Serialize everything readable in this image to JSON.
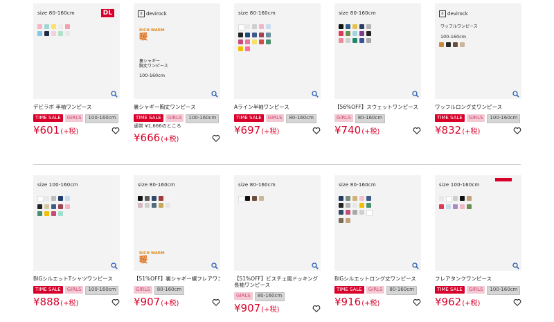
{
  "row1": [
    {
      "name": "デビラボ 半袖ワンピース",
      "tags": [
        "TIME SALE",
        "GIRLS",
        "100-160cm"
      ],
      "note": "",
      "price": "¥601",
      "tax": "(+税)",
      "size_label": "size 80-160cm",
      "brand_badge": "DL",
      "swatch_colors": [
        "#f5b5c4",
        "#9ed8d2",
        "#ffe06b",
        "#ececec",
        "#f3a0b0",
        "#88c6e6",
        "#242b47",
        "#f2d2da",
        "#b3e1c7",
        "#e8e8e8"
      ],
      "dress": "#a7dcd6",
      "hair": "#3a2a20",
      "skin": "#f1d0b6"
    },
    {
      "name": "裏シャギー胸丈ワンピース",
      "tags": [
        "TIME SALE",
        "GIRLS",
        "100-160cm"
      ],
      "note": "通常 ¥1,666のところ",
      "price": "¥666",
      "tax": "(+税)",
      "brand_text": "devirock",
      "warm_title": "RICH WARM",
      "warm_kanji": "暖",
      "feature_text": "裏シャギー\n胸丈ワンピース",
      "size_range": "100-160cm",
      "dress": "#5c4a3d",
      "hair": "#2b1e16",
      "skin": "#eed0b6"
    },
    {
      "name": "Aライン半袖ワンピース",
      "tags": [
        "TIME SALE",
        "GIRLS",
        "80-160cm"
      ],
      "note": "",
      "price": "¥697",
      "tax": "(+税)",
      "size_label": "size 80-160cm",
      "swatch_colors": [
        "#ffffff",
        "#e8e8e8",
        "#cfcfcf",
        "#f0b7c6",
        "#c7ddf0",
        "#222222",
        "#1f4a7c",
        "#3e5c8a",
        "#9e4454",
        "#6a8ea4",
        "#c84b78",
        "#e07aa0",
        "#f4e26b",
        "#d24b4b",
        "#4a8f70",
        "#f0c000",
        "#ff6f9c"
      ],
      "dress": "#9dd2c8",
      "hair": "#2b1e16",
      "skin": "#f1d2b9"
    },
    {
      "name": "【56%OFF】スウェットワンピース",
      "tags": [
        "GIRLS",
        "80-160cm"
      ],
      "note": "",
      "price": "¥740",
      "tax": "(+税)",
      "size_label": "size 80-160cm",
      "swatch_colors": [
        "#111111",
        "#2f5f88",
        "#e8c24e",
        "#2a3d5e",
        "#b4b4b4",
        "#d83a57",
        "#6b8f4e",
        "#a2d3e0",
        "#7c3e8c",
        "#232323",
        "#ef8a9b",
        "#cfcfcf",
        "#1e8a6a",
        "#3b4f9c",
        "#a8a8a8"
      ],
      "dress": "#232a34",
      "hair": "#1f150e",
      "skin": "#f1d2b9"
    },
    {
      "name": "ワッフルロング丈ワンピース",
      "tags": [
        "TIME SALE",
        "GIRLS",
        "100-160cm"
      ],
      "note": "",
      "price": "¥832",
      "tax": "(+税)",
      "brand_text": "devirock",
      "feature_text": "ワッフルワンピース",
      "size_range": "100-160cm",
      "swatch_colors": [
        "#c9893c",
        "#2a2a2a",
        "#6b4e3a",
        "#cdb59a"
      ],
      "dress": "#bb7432",
      "hair": "#3a2818",
      "skin": "#eed0b6"
    }
  ],
  "row2": [
    {
      "name": "BIGシルエットTシャツワンピース",
      "tags": [
        "TIME SALE",
        "GIRLS",
        "100-160cm"
      ],
      "note": "",
      "price": "¥888",
      "tax": "(+税)",
      "size_label": "size 100-160cm",
      "swatch_colors": [
        "#ffffff",
        "#e8e8e8",
        "#bcbcbc",
        "#1f3b6e",
        "#c7ddf0",
        "#222222",
        "#d6c7a0",
        "#3e5c8a",
        "#9e4454",
        "#f4b6c4",
        "#4a8f70",
        "#f0c000",
        "#c84b78",
        "#a1e0d0"
      ],
      "dress": "#c3c29d",
      "hair": "#2b1e16",
      "skin": "#f1d2b9",
      "cap": "#1d2a44"
    },
    {
      "name": "【51%OFF】裏シャギー裾フレアワンピース",
      "tags": [
        "GIRLS",
        "80-160cm"
      ],
      "note": "",
      "price": "¥907",
      "tax": "(+税)",
      "size_label": "size 80-160cm",
      "warm_title": "RICH WARM",
      "warm_kanji": "暖",
      "swatch_colors": [
        "#111111",
        "#5a5a5a",
        "#2f4a6a",
        "#9e3b3b",
        "#f4f4f4",
        "#d5b7c6",
        "#cfcfcf",
        "#4e6a7c",
        "#c8a75a",
        "#e6e6e6"
      ],
      "dress": "#5c7786",
      "hair": "#2b1e16",
      "skin": "#eed0b6",
      "cap": "#2a2a2a"
    },
    {
      "name": "【51%OFF】ビスチェ風ドッキング長袖ワンピース",
      "tags": [
        "GIRLS",
        "80-160cm"
      ],
      "note": "",
      "price": "¥907",
      "tax": "(+税)",
      "size_label": "size 80-160cm",
      "swatch_colors": [
        "#ffffff",
        "#111111",
        "#6b4e3a",
        "#cdb59a"
      ],
      "dress": "#f4f4f4",
      "hair": "#1f150e",
      "skin": "#f1d2b9",
      "cap": "#1a1a1a"
    },
    {
      "name": "BIGシルエットロング丈ワンピース",
      "tags": [
        "TIME SALE",
        "GIRLS",
        "80-160cm"
      ],
      "note": "",
      "price": "¥916",
      "tax": "(+税)",
      "size_label": "size 80-160cm",
      "swatch_colors": [
        "#1f3b5e",
        "#7c8c7a",
        "#d2b07a",
        "#efc2d0",
        "#3e5c8a",
        "#222222",
        "#b4b4b4",
        "#e8e8e8",
        "#f0c000",
        "#4a8f70",
        "#2e4a6b",
        "#c84b78",
        "#a8a8a8",
        "#cfcfcf",
        "#ffffff",
        "#7e6b55",
        "#c3a27a"
      ],
      "dress": "#3d6170",
      "hair": "#1f150e",
      "skin": "#f1d2b9"
    },
    {
      "name": "フレアタンクワンピース",
      "tags": [
        "TIME SALE",
        "GIRLS",
        "100-160cm"
      ],
      "note": "",
      "price": "¥962",
      "tax": "(+税)",
      "size_label": "size 100-160cm",
      "swatch_colors": [
        "#e8e8e8",
        "#ffffff",
        "#cfcfcf",
        "#111111",
        "#c3a27a",
        "#d83a57",
        "#c7ddf0",
        "#a88bc0",
        "#f0b7c6",
        "#6b8f4e"
      ],
      "dress": "#b38bbd",
      "hair": "#1f150e",
      "skin": "#f1d2b9",
      "cap": "#1d2a44",
      "badge": "#d8002a"
    }
  ],
  "colors": {
    "accent": "#d8002a",
    "girls_bg": "#f3c9d4",
    "size_bg": "#d6d6d6",
    "zoom": "#2a5db0"
  }
}
